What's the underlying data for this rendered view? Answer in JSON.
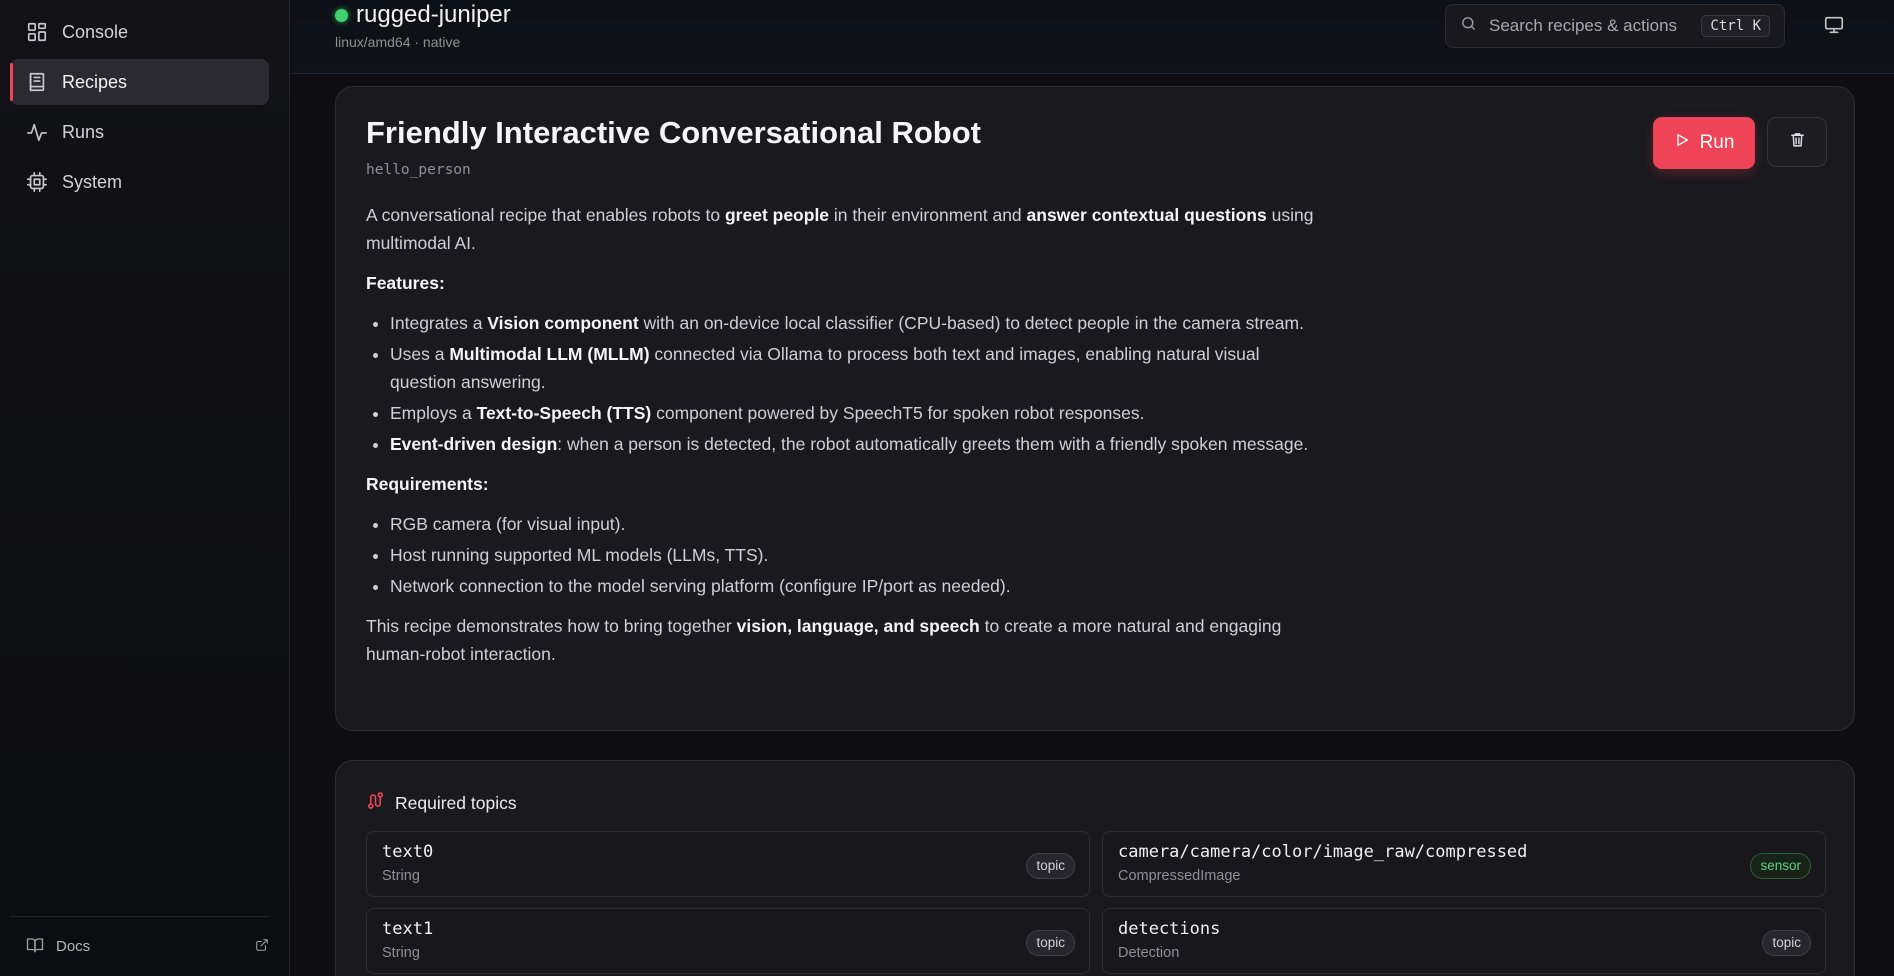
{
  "sidebar": {
    "items": [
      {
        "label": "Console",
        "icon": "grid-icon",
        "active": false
      },
      {
        "label": "Recipes",
        "icon": "book-icon",
        "active": true
      },
      {
        "label": "Runs",
        "icon": "activity-icon",
        "active": false
      },
      {
        "label": "System",
        "icon": "cpu-icon",
        "active": false
      }
    ],
    "footer": {
      "label": "Docs",
      "icon": "book-open-icon",
      "external_icon": "external-link-icon"
    }
  },
  "header": {
    "host_name": "rugged-juniper",
    "host_status": "online",
    "host_status_color": "#3fd16b",
    "host_sub": "linux/amd64 · native",
    "search": {
      "placeholder": "Search recipes & actions",
      "shortcut": "Ctrl K"
    },
    "display_icon": "monitor-icon"
  },
  "recipe": {
    "title": "Friendly Interactive Conversational Robot",
    "slug": "hello_person",
    "run_label": "Run",
    "delete_icon": "trash-icon",
    "accent": "#ef4457",
    "intro": {
      "a": "A conversational recipe that enables robots to ",
      "b": "greet people",
      "c": " in their environment and ",
      "d": "answer contextual questions",
      "e": " using multimodal AI."
    },
    "features_heading": "Features:",
    "features": [
      {
        "pre": "Integrates a ",
        "bold": "Vision component",
        "post": " with an on-device local classifier (CPU-based) to detect people in the camera stream."
      },
      {
        "pre": "Uses a ",
        "bold": "Multimodal LLM (MLLM)",
        "post": " connected via Ollama to process both text and images, enabling natural visual question answering."
      },
      {
        "pre": "Employs a ",
        "bold": "Text-to-Speech (TTS)",
        "post": " component powered by SpeechT5 for spoken robot responses."
      },
      {
        "pre": "",
        "bold": "Event-driven design",
        "post": ": when a person is detected, the robot automatically greets them with a friendly spoken message."
      }
    ],
    "requirements_heading": "Requirements:",
    "requirements": [
      "RGB camera (for visual input).",
      "Host running supported ML models (LLMs, TTS).",
      "Network connection to the model serving platform (configure IP/port as needed)."
    ],
    "outro": {
      "a": "This recipe demonstrates how to bring together ",
      "b": "vision, language, and speech",
      "c": " to create a more natural and engaging human-robot interaction."
    }
  },
  "topics": {
    "heading": "Required topics",
    "icon": "route-icon",
    "items": [
      {
        "name": "text0",
        "type": "String",
        "badge": "topic"
      },
      {
        "name": "camera/camera/color/image_raw/compressed",
        "type": "CompressedImage",
        "badge": "sensor"
      },
      {
        "name": "text1",
        "type": "String",
        "badge": "topic"
      },
      {
        "name": "detections",
        "type": "Detection",
        "badge": "topic"
      }
    ]
  }
}
